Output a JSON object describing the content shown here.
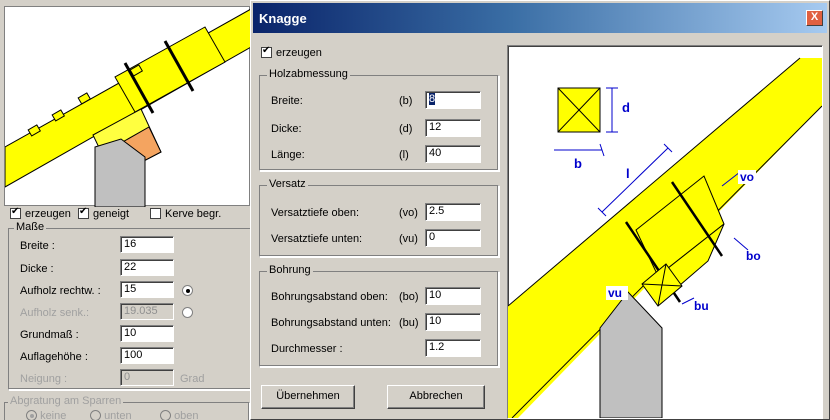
{
  "background": {
    "title": "",
    "checks": {
      "erzeugen": "erzeugen",
      "geneigt": "geneigt",
      "kerve": "Kerve begr."
    },
    "masse_title": "Maße",
    "fields": {
      "breite": {
        "label": "Breite :",
        "value": "16"
      },
      "dicke": {
        "label": "Dicke :",
        "value": "22"
      },
      "aufholz_rechtw": {
        "label": "Aufholz rechtw. :",
        "value": "15"
      },
      "aufholz_senk": {
        "label": "Aufholz senk.:",
        "value": "19.035"
      },
      "grundmass": {
        "label": "Grundmaß :",
        "value": "10"
      },
      "auflagehoehe": {
        "label": "Auflagehöhe :",
        "value": "100"
      },
      "neigung": {
        "label": "Neigung :",
        "value": "0",
        "unit": "Grad"
      }
    },
    "abgratung_title": "Abgratung am Sparren",
    "abgratung_options": [
      "keine",
      "unten",
      "oben"
    ]
  },
  "dialog": {
    "title": "Knagge",
    "close_label": "X",
    "erzeugen_label": "erzeugen",
    "holz": {
      "title": "Holzabmessung",
      "rows": [
        {
          "label": "Breite:",
          "code": "(b)",
          "value": "8"
        },
        {
          "label": "Dicke:",
          "code": "(d)",
          "value": "12"
        },
        {
          "label": "Länge:",
          "code": "(l)",
          "value": "40"
        }
      ]
    },
    "versatz": {
      "title": "Versatz",
      "rows": [
        {
          "label": "Versatztiefe oben:",
          "code": "(vo)",
          "value": "2.5"
        },
        {
          "label": "Versatztiefe unten:",
          "code": "(vu)",
          "value": "0"
        }
      ]
    },
    "bohrung": {
      "title": "Bohrung",
      "rows": [
        {
          "label": "Bohrungsabstand oben:",
          "code": "(bo)",
          "value": "10"
        },
        {
          "label": "Bohrungsabstand unten:",
          "code": "(bu)",
          "value": "10"
        },
        {
          "label": "Durchmesser :",
          "code": "",
          "value": "1.2"
        }
      ]
    },
    "ok_label": "Übernehmen",
    "cancel_label": "Abbrechen",
    "diagram_labels": {
      "d": "d",
      "b": "b",
      "l": "l",
      "vo": "vo",
      "bo": "bo",
      "vu": "vu",
      "bu": "bu"
    }
  },
  "colors": {
    "title_start": "#0a246a",
    "title_end": "#a6caf0",
    "timber": "#ffff00",
    "bracket_orange": "#f4a460",
    "wall_gray": "#c0c0c0",
    "dimension_blue": "#0000cc"
  }
}
